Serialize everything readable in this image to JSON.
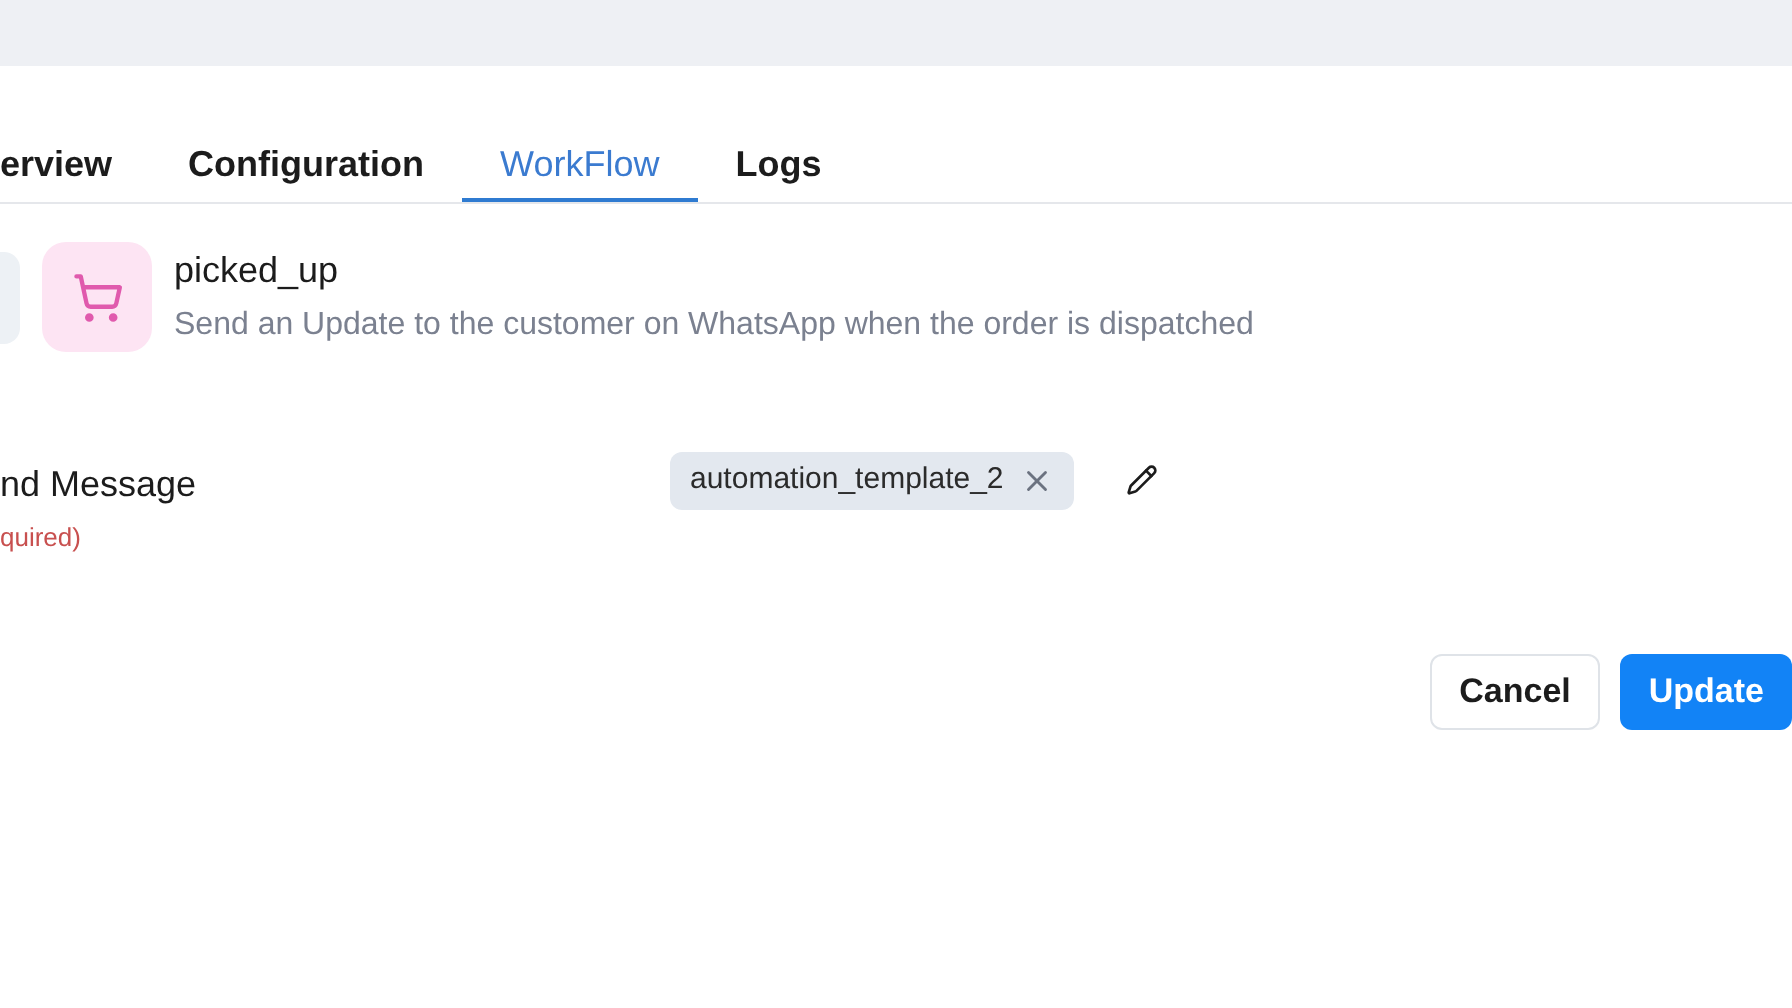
{
  "tabs": [
    {
      "label": "erview",
      "selected": false
    },
    {
      "label": "Configuration",
      "selected": false
    },
    {
      "label": "WorkFlow",
      "selected": true
    },
    {
      "label": "Logs",
      "selected": false
    }
  ],
  "event": {
    "title": "picked_up",
    "description": "Send an Update to the customer on WhatsApp when the order is dispatched"
  },
  "field": {
    "label": "nd Message",
    "note": "quired)",
    "chip": "automation_template_2"
  },
  "buttons": [
    {
      "label": "Cancel",
      "kind": "secondary"
    },
    {
      "label": "Update",
      "kind": "primary"
    }
  ]
}
